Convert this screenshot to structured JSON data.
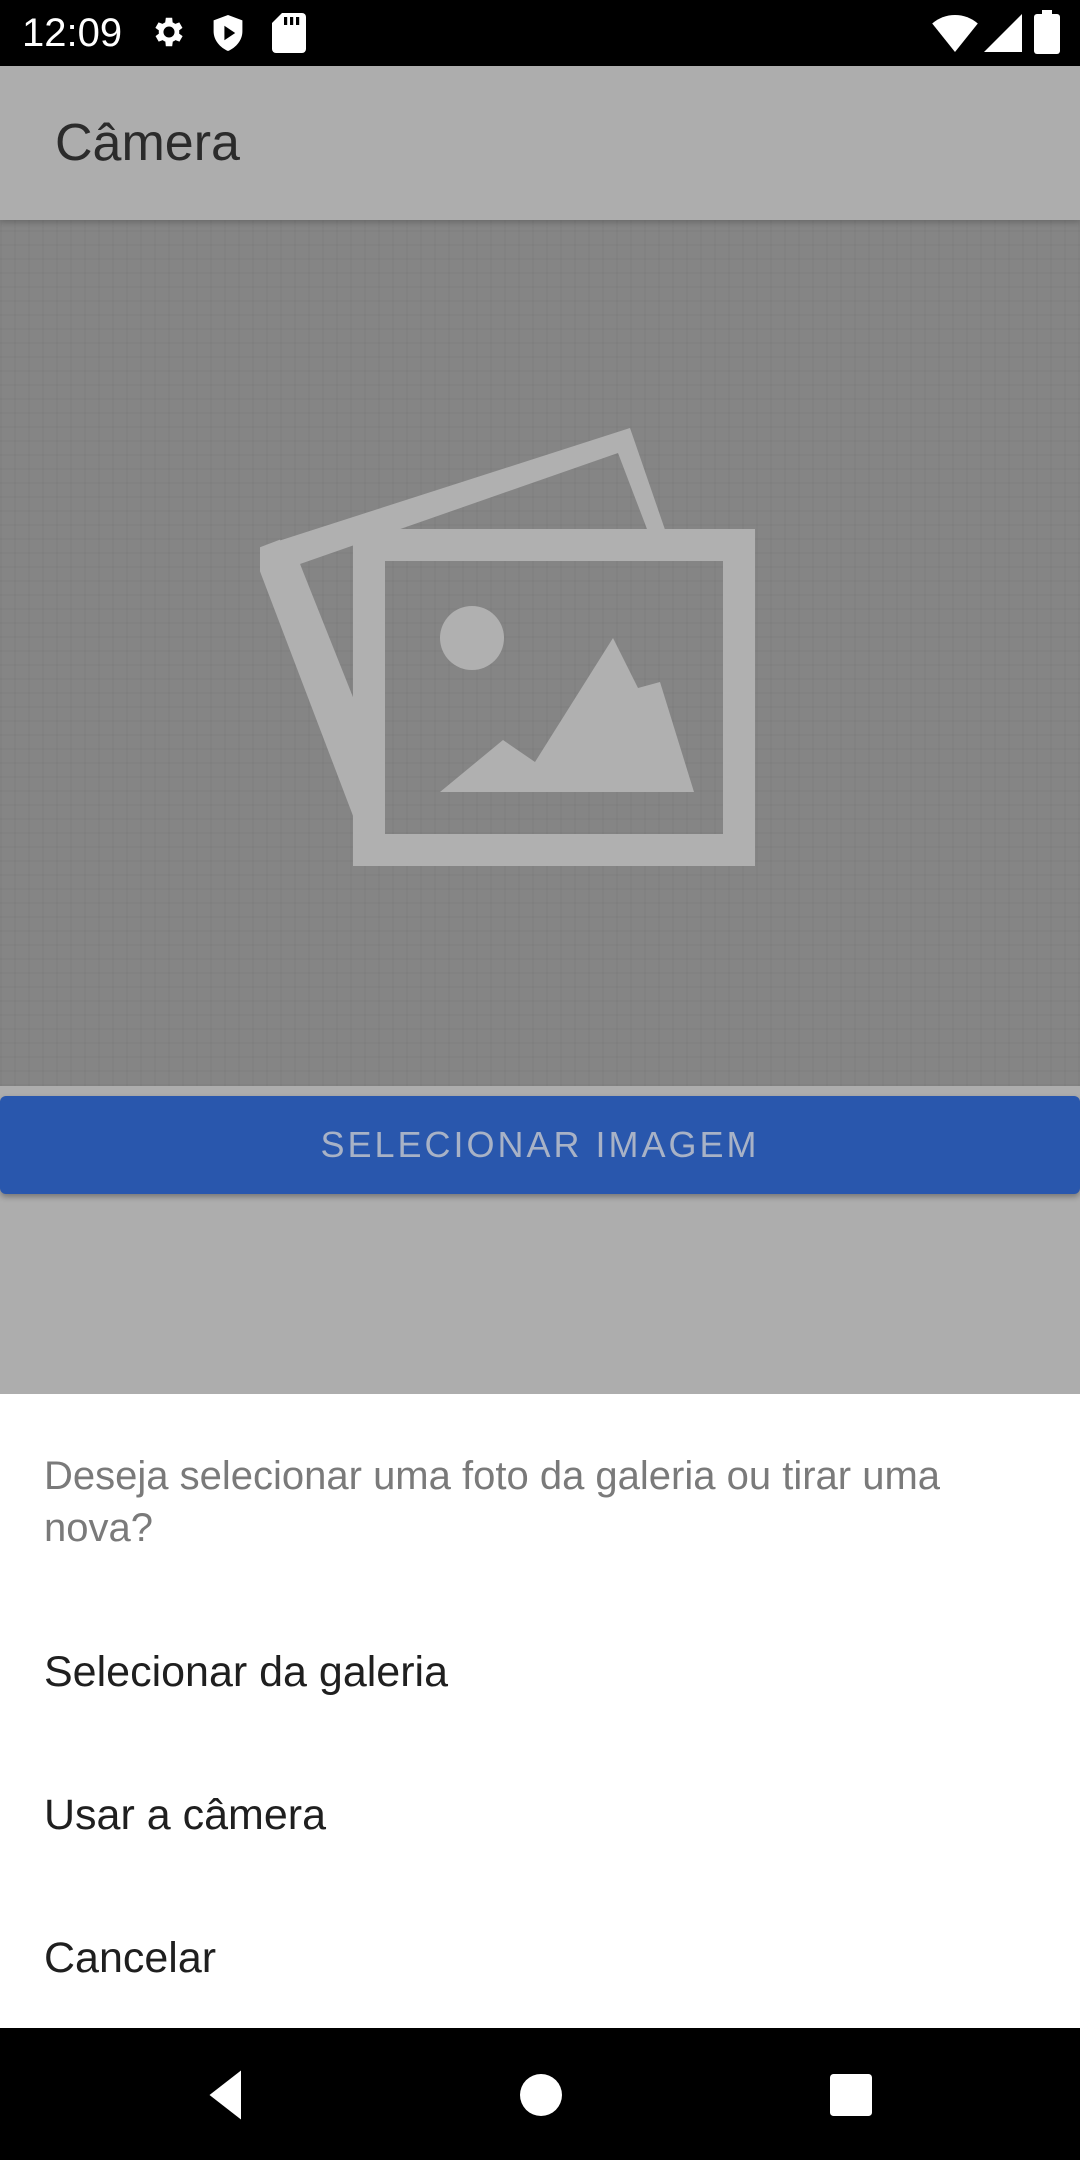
{
  "status_bar": {
    "time": "12:09",
    "icons_left": [
      "gear-icon",
      "shield-icon",
      "sd-card-icon"
    ],
    "icons_right": [
      "wifi-icon",
      "signal-icon",
      "battery-icon"
    ]
  },
  "app_bar": {
    "title": "Câmera"
  },
  "content": {
    "placeholder_icon": "photos-placeholder-icon",
    "select_button_label": "SELECIONAR IMAGEM"
  },
  "bottom_sheet": {
    "message": "Deseja selecionar uma foto da galeria ou tirar uma nova?",
    "options": [
      {
        "label": "Selecionar da galeria"
      },
      {
        "label": "Usar a câmera"
      },
      {
        "label": "Cancelar"
      }
    ]
  },
  "nav_bar": {
    "buttons": [
      "back-icon",
      "home-icon",
      "recents-icon"
    ]
  },
  "colors": {
    "button_blue": "#2957ad",
    "app_bar_scrim": "#adadad",
    "sheet_background": "#ffffff"
  }
}
